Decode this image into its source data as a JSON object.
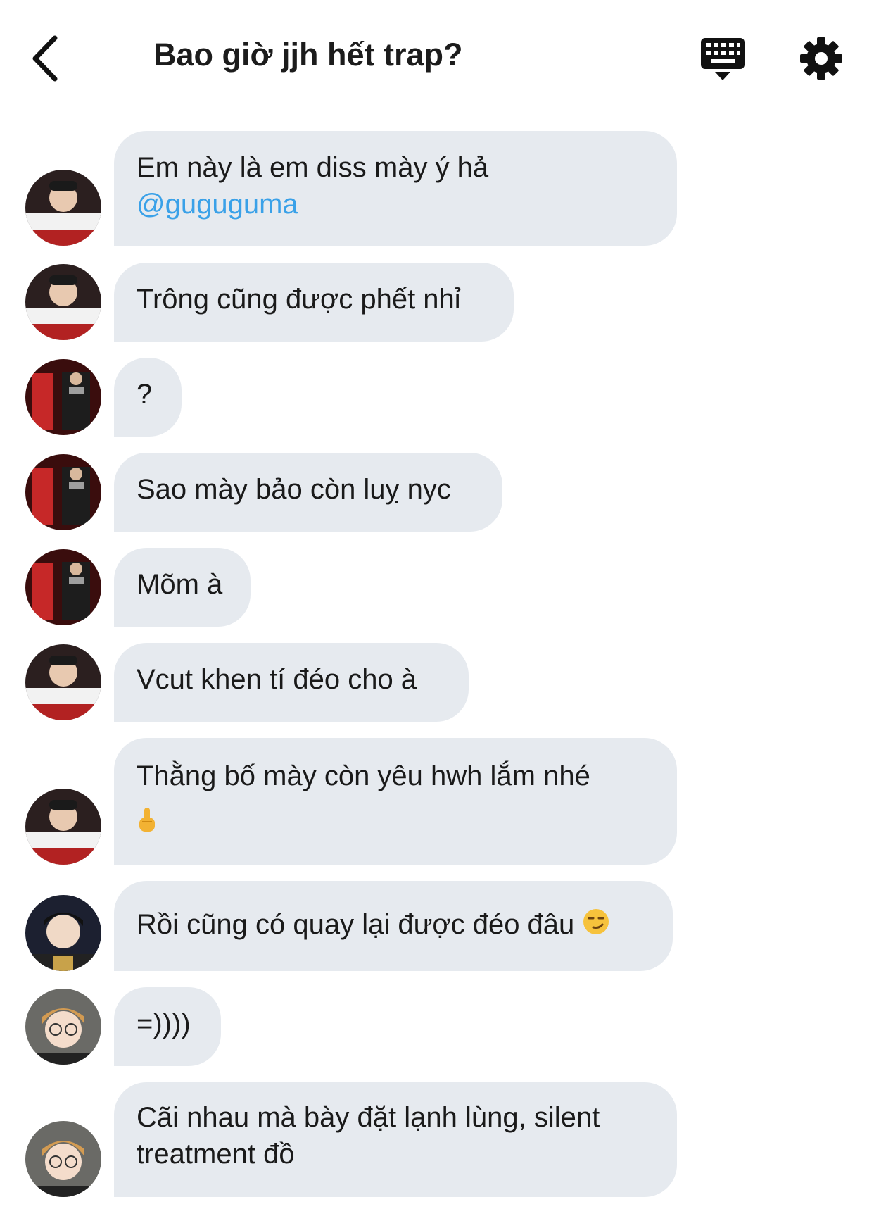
{
  "header": {
    "title": "Bao giờ jjh hết trap?",
    "back_icon": "chevron-left-icon",
    "keyboard_icon": "keyboard-icon",
    "settings_icon": "gear-icon"
  },
  "messages": [
    {
      "text": "Em này là em diss mày ý hả",
      "mention": "@guguguma",
      "avatar": "avatar-a"
    },
    {
      "text": "Trông cũng được phết nhỉ",
      "avatar": "avatar-a"
    },
    {
      "text": "?",
      "avatar": "avatar-b"
    },
    {
      "text": "Sao mày bảo còn luỵ nyc",
      "avatar": "avatar-b"
    },
    {
      "text": "Mõm à",
      "avatar": "avatar-b"
    },
    {
      "text": "Vcut khen tí đéo cho à",
      "avatar": "avatar-a"
    },
    {
      "text": "Thằng bố mày còn yêu hwh lắm nhé",
      "emoji": "middle-finger-icon",
      "avatar": "avatar-a"
    },
    {
      "text": "Rồi cũng có quay lại được đéo đâu",
      "emoji": "smirk-face-icon",
      "avatar": "avatar-c"
    },
    {
      "text": "=))))",
      "avatar": "avatar-d"
    },
    {
      "text": "Cãi nhau mà bày đặt lạnh lùng, silent treatment đồ",
      "avatar": "avatar-d"
    }
  ],
  "colors": {
    "bubble": "#e6eaef",
    "mention": "#3aa1e8",
    "text": "#1a1a1a"
  }
}
